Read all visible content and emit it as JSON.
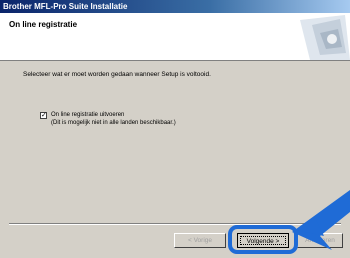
{
  "window": {
    "title": "Brother MFL-Pro Suite Installatie"
  },
  "header": {
    "title": "On line registratie",
    "art_icon": "tools-graphic"
  },
  "body": {
    "description": "Selecteer wat er moet worden gedaan wanneer Setup is voltooid.",
    "checkbox": {
      "label": "On line registratie uitvoeren",
      "note": "(Dit is mogelijk niet in alle landen beschikbaar.)",
      "checked": true
    }
  },
  "buttons": {
    "back": "< Vorige",
    "next": "Volgende >",
    "cancel": "Annuleren"
  },
  "colors": {
    "highlight": "#1f6bd6",
    "titlebar": "#0a246a"
  }
}
